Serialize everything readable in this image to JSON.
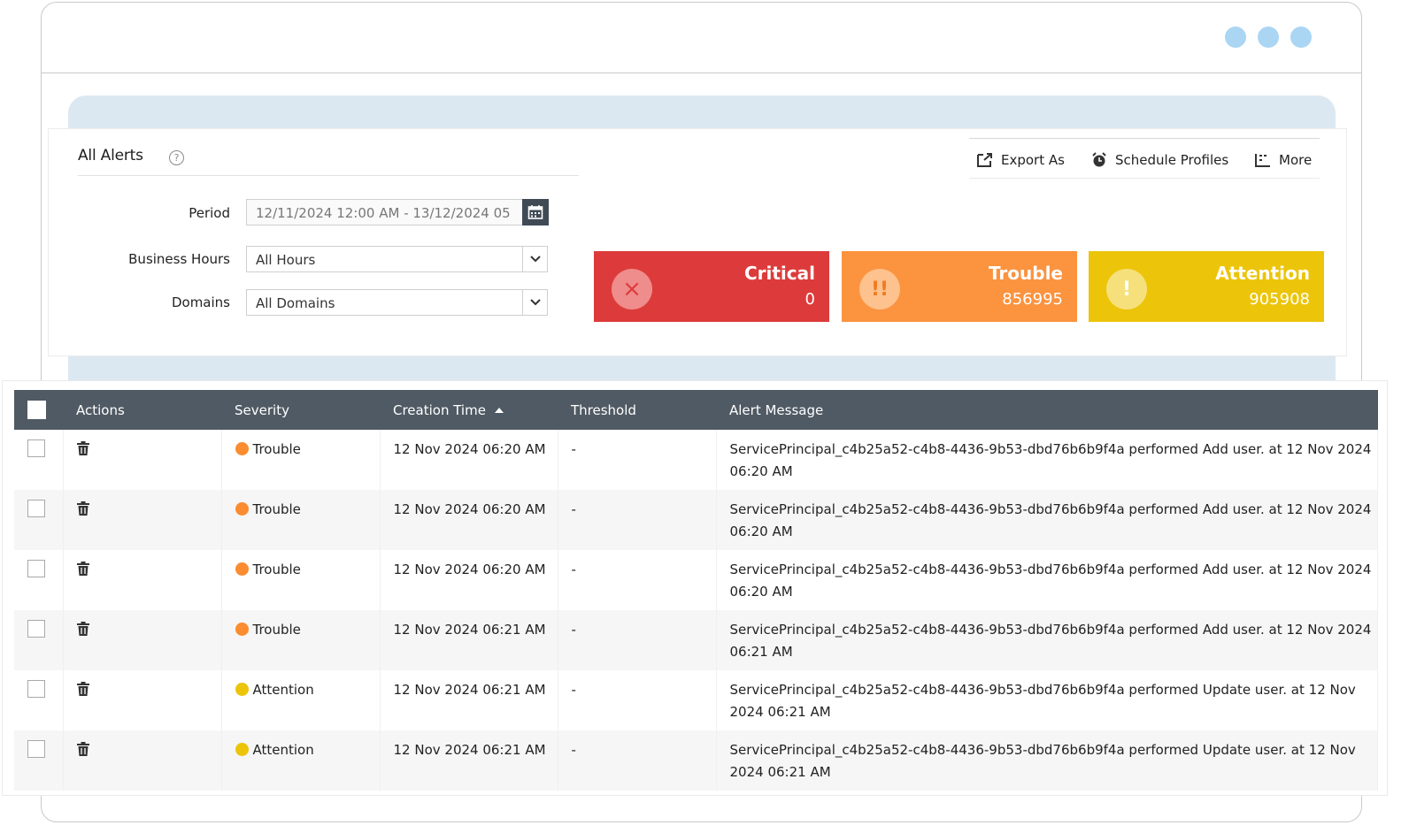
{
  "page": {
    "title": "All Alerts",
    "help_icon": "?"
  },
  "toolbar": {
    "export_label": "Export As",
    "schedule_label": "Schedule Profiles",
    "more_label": "More"
  },
  "filters": {
    "period_label": "Period",
    "period_value": "12/11/2024 12:00 AM - 13/12/2024 05",
    "business_hours_label": "Business Hours",
    "business_hours_value": "All Hours",
    "domains_label": "Domains",
    "domains_value": "All Domains"
  },
  "summary": {
    "critical": {
      "label": "Critical",
      "count": "0",
      "icon": "×",
      "color": "#dd3b3b"
    },
    "trouble": {
      "label": "Trouble",
      "count": "856995",
      "icon": "!!",
      "color": "#fb933f"
    },
    "attention": {
      "label": "Attention",
      "count": "905908",
      "icon": "!",
      "color": "#ecc40a"
    }
  },
  "table": {
    "columns": {
      "actions": "Actions",
      "severity": "Severity",
      "creation_time": "Creation Time",
      "threshold": "Threshold",
      "alert_message": "Alert Message"
    },
    "sorted_column": "creation_time",
    "sort_direction": "ascending",
    "rows": [
      {
        "severity": "Trouble",
        "severity_color": "#fb8c2f",
        "time": "12 Nov 2024 06:20 AM",
        "threshold": "-",
        "message": "ServicePrincipal_c4b25a52-c4b8-4436-9b53-dbd76b6b9f4a performed Add user. at 12 Nov 2024 06:20 AM"
      },
      {
        "severity": "Trouble",
        "severity_color": "#fb8c2f",
        "time": "12 Nov 2024 06:20 AM",
        "threshold": "-",
        "message": "ServicePrincipal_c4b25a52-c4b8-4436-9b53-dbd76b6b9f4a performed Add user. at 12 Nov 2024 06:20 AM"
      },
      {
        "severity": "Trouble",
        "severity_color": "#fb8c2f",
        "time": "12 Nov 2024 06:20 AM",
        "threshold": "-",
        "message": "ServicePrincipal_c4b25a52-c4b8-4436-9b53-dbd76b6b9f4a performed Add user. at 12 Nov 2024 06:20 AM"
      },
      {
        "severity": "Trouble",
        "severity_color": "#fb8c2f",
        "time": "12 Nov 2024 06:21 AM",
        "threshold": "-",
        "message": "ServicePrincipal_c4b25a52-c4b8-4436-9b53-dbd76b6b9f4a performed Add user. at 12 Nov 2024 06:21 AM"
      },
      {
        "severity": "Attention",
        "severity_color": "#ecc40a",
        "time": "12 Nov 2024 06:21 AM",
        "threshold": "-",
        "message": "ServicePrincipal_c4b25a52-c4b8-4436-9b53-dbd76b6b9f4a performed Update user. at 12 Nov 2024 06:21 AM"
      },
      {
        "severity": "Attention",
        "severity_color": "#ecc40a",
        "time": "12 Nov 2024 06:21 AM",
        "threshold": "-",
        "message": "ServicePrincipal_c4b25a52-c4b8-4436-9b53-dbd76b6b9f4a performed Update user. at 12 Nov 2024 06:21 AM"
      }
    ]
  },
  "window_controls": [
    "window-dot",
    "window-dot",
    "window-dot"
  ]
}
